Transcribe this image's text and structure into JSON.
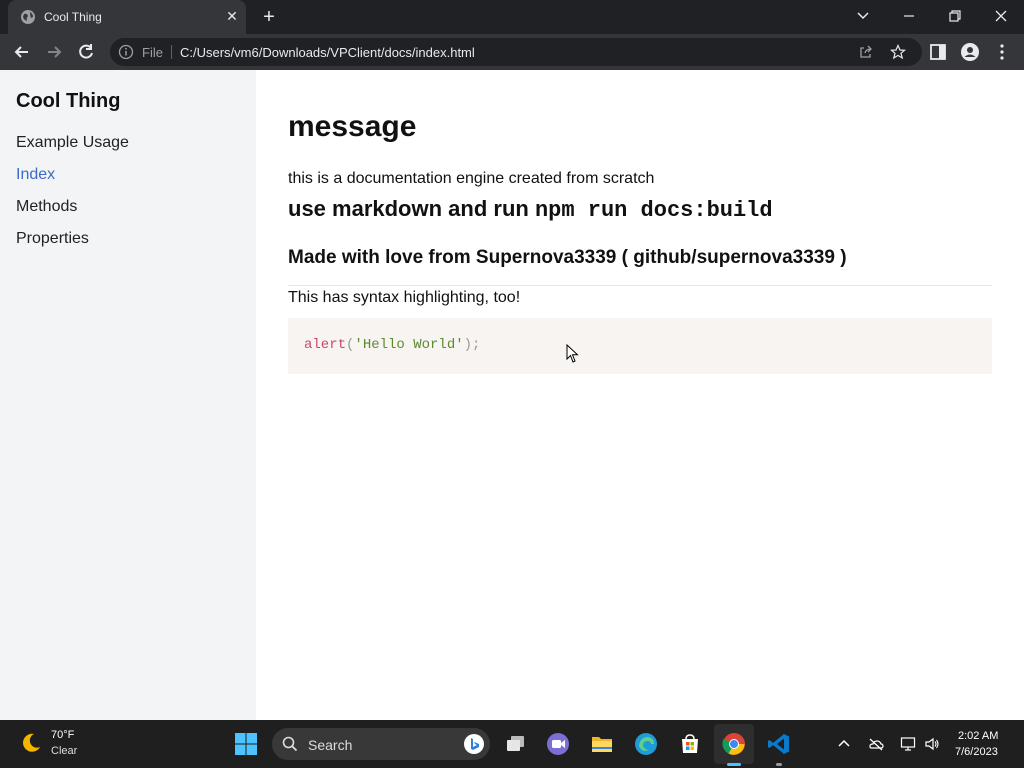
{
  "browser": {
    "tab_title": "Cool Thing",
    "omnibox_scheme": "File",
    "url": "C:/Users/vm6/Downloads/VPClient/docs/index.html"
  },
  "sidebar": {
    "brand": "Cool Thing",
    "items": [
      {
        "label": "Example Usage",
        "active": false
      },
      {
        "label": "Index",
        "active": true
      },
      {
        "label": "Methods",
        "active": false
      },
      {
        "label": "Properties",
        "active": false
      }
    ]
  },
  "content": {
    "heading": "message",
    "intro": "this is a documentation engine created from scratch",
    "h2_text": "use markdown and run ",
    "h2_code": "npm run docs:build",
    "h3": "Made with love from Supernova3339 ( github/supernova3339 )",
    "note": "This has syntax highlighting, too!",
    "code": {
      "fn": "alert",
      "open": "(",
      "str": "'Hello World'",
      "close": ");"
    }
  },
  "taskbar": {
    "temperature": "70°F",
    "condition": "Clear",
    "search_label": "Search",
    "time": "2:02 AM",
    "date": "7/6/2023"
  },
  "colors": {
    "accent_link": "#3c6bc9",
    "code_fn": "#c34a6a",
    "code_str": "#5c8b2f"
  }
}
